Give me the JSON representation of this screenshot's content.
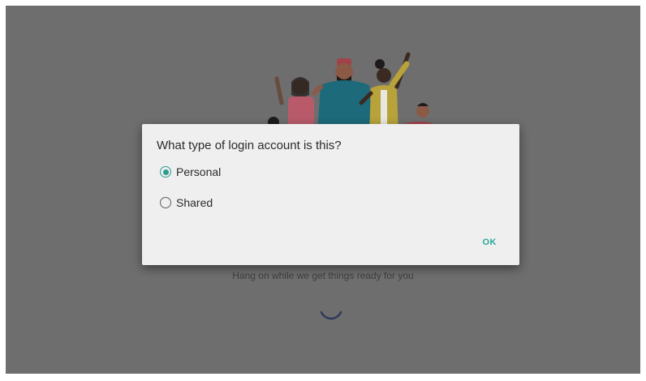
{
  "background": {
    "loading_text": "Hang on while we get things ready for you"
  },
  "dialog": {
    "title": "What type of login account is this?",
    "options": [
      {
        "label": "Personal",
        "selected": true
      },
      {
        "label": "Shared",
        "selected": false
      }
    ],
    "ok_label": "OK",
    "accent_color": "#2a9d8f"
  },
  "icons": {
    "illustration": "people-waving-illustration",
    "spinner": "loading-spinner-icon"
  }
}
